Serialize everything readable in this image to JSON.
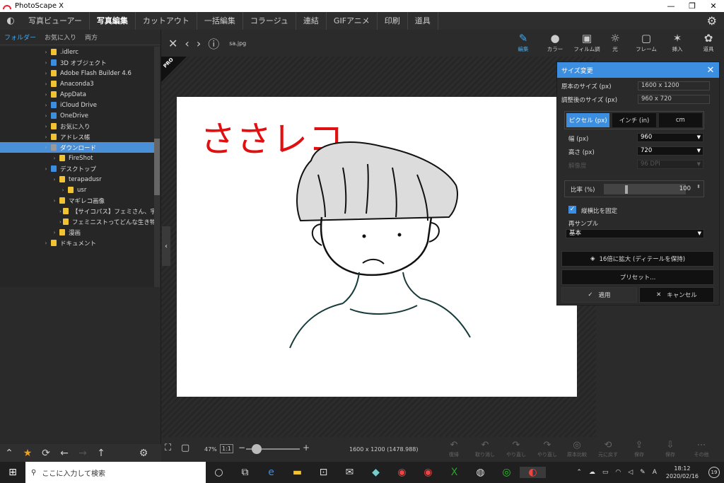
{
  "window": {
    "title": "PhotoScape X",
    "controls": [
      "—",
      "❐",
      "✕"
    ]
  },
  "menu": {
    "tabs": [
      "写真ビューアー",
      "写真編集",
      "カットアウト",
      "一括編集",
      "コラージュ",
      "連結",
      "GIFアニメ",
      "印刷",
      "道具"
    ],
    "active": "写真編集"
  },
  "folder_tabs": [
    "フォルダー",
    "お気に入り",
    "両方"
  ],
  "tree": [
    {
      "label": ".idlerc",
      "indent": 1,
      "icon": "folder"
    },
    {
      "label": "3D オブジェクト",
      "indent": 1,
      "icon": "folder-blue"
    },
    {
      "label": "Adobe Flash Builder 4.6",
      "indent": 1,
      "icon": "folder"
    },
    {
      "label": "Anaconda3",
      "indent": 1,
      "icon": "folder"
    },
    {
      "label": "AppData",
      "indent": 1,
      "icon": "folder"
    },
    {
      "label": "iCloud Drive",
      "indent": 1,
      "icon": "folder-blue"
    },
    {
      "label": "OneDrive",
      "indent": 1,
      "icon": "folder-blue"
    },
    {
      "label": "お気に入り",
      "indent": 1,
      "icon": "folder"
    },
    {
      "label": "アドレス帳",
      "indent": 1,
      "icon": "folder"
    },
    {
      "label": "ダウンロード",
      "indent": 1,
      "icon": "folder-grey",
      "selected": true
    },
    {
      "label": "FireShot",
      "indent": 2,
      "icon": "folder"
    },
    {
      "label": "デスクトップ",
      "indent": 1,
      "icon": "folder-blue"
    },
    {
      "label": "terapadusr",
      "indent": 2,
      "icon": "folder"
    },
    {
      "label": "usr",
      "indent": 3,
      "icon": "folder"
    },
    {
      "label": "マギレコ画像",
      "indent": 2,
      "icon": "folder"
    },
    {
      "label": "【サイコパス】フェミさん、宇崎ち",
      "indent": 3,
      "icon": "folder"
    },
    {
      "label": "フェミニストってどんな生き物？",
      "indent": 3,
      "icon": "folder"
    },
    {
      "label": "漫画",
      "indent": 2,
      "icon": "folder"
    },
    {
      "label": "ドキュメント",
      "indent": 1,
      "icon": "folder"
    }
  ],
  "editor": {
    "filename": "sa.jpg",
    "badge": "PRO"
  },
  "photo": {
    "overlay_text": "ささレコ"
  },
  "tools": [
    {
      "label": "編集",
      "icon": "edit-icon",
      "glyph": "✎"
    },
    {
      "label": "カラー",
      "icon": "color-icon",
      "glyph": "●"
    },
    {
      "label": "フィルム調",
      "icon": "film-icon",
      "glyph": "▣"
    },
    {
      "label": "光",
      "icon": "light-icon",
      "glyph": "☼"
    },
    {
      "label": "フレーム",
      "icon": "frame-icon",
      "glyph": "▢"
    },
    {
      "label": "挿入",
      "icon": "insert-icon",
      "glyph": "✶"
    },
    {
      "label": "道具",
      "icon": "tools-icon",
      "glyph": "✿"
    }
  ],
  "dialog": {
    "title": "サイズ変更",
    "original_label": "原本のサイズ (px)",
    "original_value": "1600 x 1200",
    "adjusted_label": "調整後のサイズ (px)",
    "adjusted_value": "960 x 720",
    "units": [
      "ピクセル (px)",
      "インチ (in)",
      "cm"
    ],
    "width_label": "幅 (px)",
    "width_value": "960",
    "height_label": "高さ (px)",
    "height_value": "720",
    "resolution_label": "解像度",
    "resolution_value": "96 DPI",
    "ratio_label": "比率 (%)",
    "ratio_value": "100",
    "keep_ratio_label": "縦横比を固定",
    "resample_label": "再サンプル",
    "resample_value": "基本",
    "upscale_label": "16倍に拡大 (ディテールを保持)",
    "preset_label": "プリセット...",
    "apply_label": "適用",
    "cancel_label": "キャンセル"
  },
  "bottom": {
    "zoom": "47%",
    "one_to_one": "1:1",
    "info": "1600 x 1200 (1478.988)",
    "actions": [
      "復帰",
      "取り消し",
      "やり直し",
      "やり直し",
      "原本比較",
      "元に戻す",
      "保存",
      "保存",
      "その他"
    ]
  },
  "taskbar": {
    "search_placeholder": "ここに入力して検索",
    "time": "18:12",
    "date": "2020/02/16",
    "notif": "19",
    "ime": "A"
  }
}
